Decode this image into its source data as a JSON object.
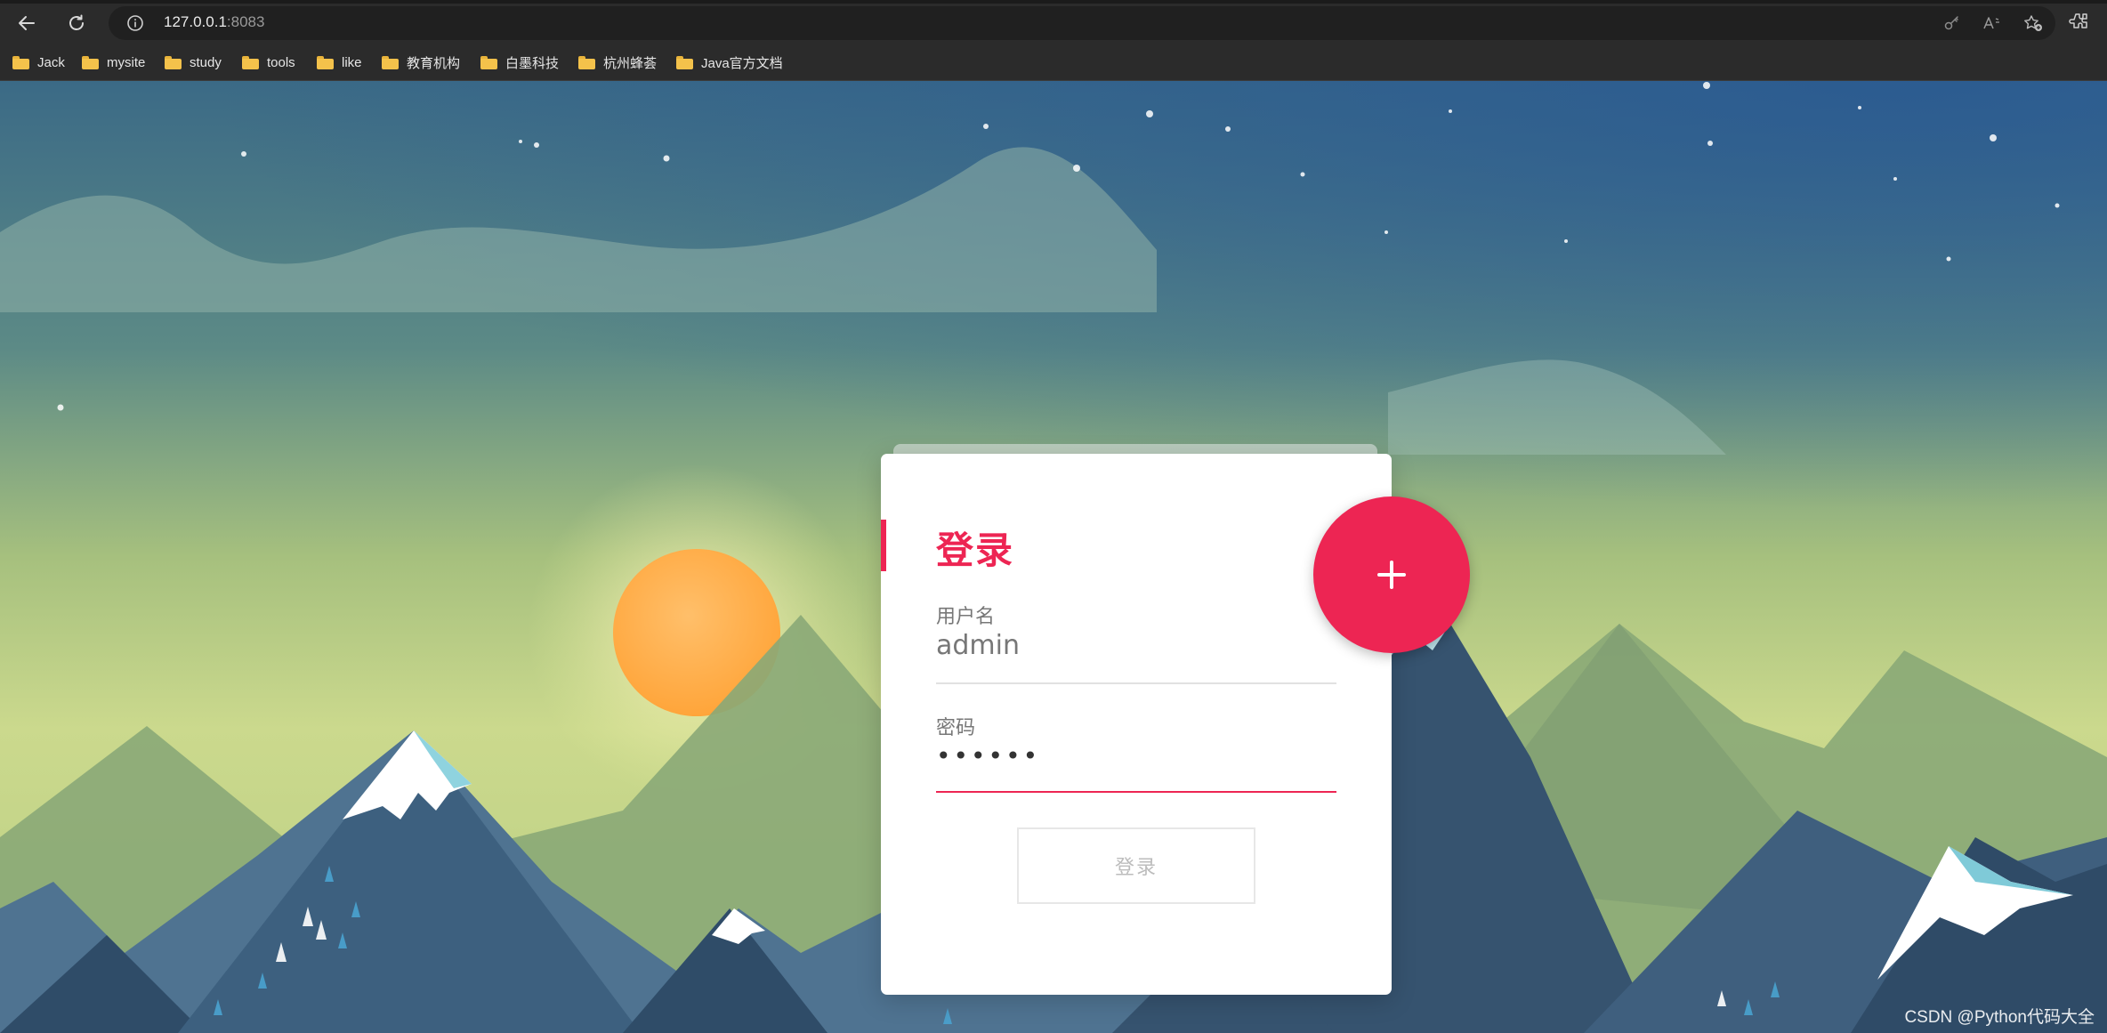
{
  "browser": {
    "url_host": "127.0.0.1",
    "url_port": ":8083",
    "bookmarks": [
      {
        "label": "Jack"
      },
      {
        "label": "mysite"
      },
      {
        "label": "study"
      },
      {
        "label": "tools"
      },
      {
        "label": "like"
      },
      {
        "label": "教育机构"
      },
      {
        "label": "白墨科技"
      },
      {
        "label": "杭州蜂荟"
      },
      {
        "label": "Java官方文档"
      }
    ]
  },
  "login": {
    "title": "登录",
    "username_label": "用户名",
    "username_value": "admin",
    "password_label": "密码",
    "password_masked": "••••••",
    "submit_label": "登录",
    "fab_symbol": "+"
  },
  "colors": {
    "accent": "#ed2553",
    "sky_top": "#2f5e8c",
    "horizon": "#c9d98a",
    "sun": "#ffab40"
  },
  "watermark": "CSDN @Python代码大全"
}
